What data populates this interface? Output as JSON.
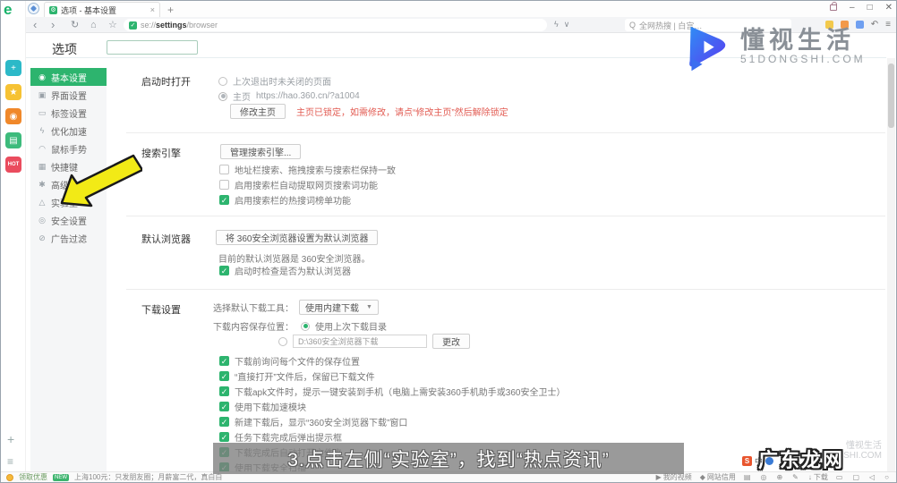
{
  "window": {
    "tab": {
      "title": "选项 - 基本设置",
      "close": "×"
    },
    "new_tab": "+",
    "controls": {
      "min": "–",
      "max": "□",
      "close": "✕"
    },
    "nav": {
      "back": "‹",
      "forward": "›",
      "reload": "↻",
      "home": "⌂",
      "star": "☆"
    },
    "address": {
      "scheme": "se://",
      "bold": "settings",
      "rest": "/browser",
      "flash": "ϟ",
      "caret": "∨"
    },
    "search": {
      "icon": "Q",
      "text": "全网热搜 | 白宫…"
    },
    "menu": "≡",
    "undo": "↶"
  },
  "sidebar": {
    "icons": [
      {
        "name": "health-icon",
        "glyph": "+",
        "color": "#2cb9c8"
      },
      {
        "name": "favorites-icon",
        "glyph": "★",
        "color": "#f6c233"
      },
      {
        "name": "reader-icon",
        "glyph": "◉",
        "color": "#f0882a"
      },
      {
        "name": "wallet-icon",
        "glyph": "▤",
        "color": "#3dbb7c"
      },
      {
        "name": "hot-icon",
        "glyph": "HOT",
        "color": "#ea4c5e",
        "small": true
      }
    ],
    "add": "+",
    "list": "≡"
  },
  "options": {
    "title": "选项",
    "nav": [
      {
        "icon": "◉",
        "label": "基本设置",
        "active": true
      },
      {
        "icon": "▣",
        "label": "界面设置",
        "active": false
      },
      {
        "icon": "▭",
        "label": "标签设置",
        "active": false
      },
      {
        "icon": "ϟ",
        "label": "优化加速",
        "active": false
      },
      {
        "icon": "◠",
        "label": "鼠标手势",
        "active": false
      },
      {
        "icon": "▦",
        "label": "快捷键",
        "active": false
      },
      {
        "icon": "✱",
        "label": "高级设置",
        "active": false
      },
      {
        "icon": "△",
        "label": "实验室",
        "active": false
      },
      {
        "icon": "◎",
        "label": "安全设置",
        "active": false
      },
      {
        "icon": "⊘",
        "label": "广告过滤",
        "active": false
      }
    ]
  },
  "sections": {
    "startup": {
      "label": "启动时打开",
      "radio_last": "上次退出时未关闭的页面",
      "radio_home_prefix": "主页",
      "radio_home_url": "https://hao.360.cn/?a1004",
      "modify_button": "修改主页",
      "locked_note": "主页已锁定，如需修改，请点“修改主页”然后解除锁定"
    },
    "search_engine": {
      "label": "搜索引擎",
      "manage_button": "管理搜索引擎...",
      "checkboxes": [
        {
          "checked": false,
          "label": "地址栏搜索、拖拽搜索与搜索栏保持一致"
        },
        {
          "checked": false,
          "label": "启用搜索栏自动提取网页搜索词功能"
        },
        {
          "checked": true,
          "label": "启用搜索栏的热搜词榜单功能"
        }
      ]
    },
    "default_browser": {
      "label": "默认浏览器",
      "set_button": "将 360安全浏览器设置为默认浏览器",
      "current": "目前的默认浏览器是 360安全浏览器。",
      "checkbox": {
        "checked": true,
        "label": "启动时检查是否为默认浏览器"
      }
    },
    "download": {
      "label": "下载设置",
      "tool_label": "选择默认下载工具：",
      "tool_value": "使用内建下载",
      "tool_caret": "▼",
      "location_label": "下载内容保存位置：",
      "radio_last_dir": "使用上次下载目录",
      "path": "D:\\360安全浏览器下载",
      "change_button": "更改",
      "checkboxes": [
        {
          "checked": true,
          "label": "下载前询问每个文件的保存位置"
        },
        {
          "checked": true,
          "label": "“直接打开”文件后，保留已下载文件"
        },
        {
          "checked": true,
          "label": "下载apk文件时，提示一键安装到手机（电脑上需安装360手机助手或360安全卫士）"
        },
        {
          "checked": true,
          "label": "使用下载加速模块"
        },
        {
          "checked": true,
          "label": "新建下载后，显示“360安全浏览器下载”窗口"
        },
        {
          "checked": true,
          "label": "任务下载完成后弹出提示框"
        },
        {
          "checked": true,
          "label": "下载完成后自动打开文件夹"
        },
        {
          "checked": true,
          "label": "使用下载安全扫描"
        }
      ]
    }
  },
  "subtitle": "3.点击左侧“实验室”，找到“热点资讯”",
  "watermark": {
    "brand": "懂视生活",
    "site": "51DONGSHI.COM",
    "corner": "广东龙网",
    "corner_faint_1": "懂视生活",
    "corner_faint_2": "51DONGSHI.COM"
  },
  "ime": {
    "s": "S",
    "zh": "中",
    "mic": "●"
  },
  "statusbar": {
    "promo": "领取优惠",
    "badge": "NEW",
    "ticker": "上海100元：只发朋友圈；月薪富二代，真白白",
    "right": [
      {
        "icon": "▶",
        "label": "我的视频"
      },
      {
        "icon": "◆",
        "label": "网站信用"
      },
      {
        "icon": "▤",
        "label": ""
      },
      {
        "icon": "◎",
        "label": ""
      },
      {
        "icon": "⊕",
        "label": ""
      },
      {
        "icon": "✎",
        "label": ""
      },
      {
        "icon": "↓",
        "label": "下载"
      },
      {
        "icon": "▭",
        "label": ""
      },
      {
        "icon": "▢",
        "label": ""
      },
      {
        "icon": "◁",
        "label": ""
      },
      {
        "icon": "○",
        "label": ""
      }
    ]
  },
  "accent": {
    "green": "#2db46e",
    "red": "#e25b52",
    "yellow_arrow": "#f2ea16"
  }
}
